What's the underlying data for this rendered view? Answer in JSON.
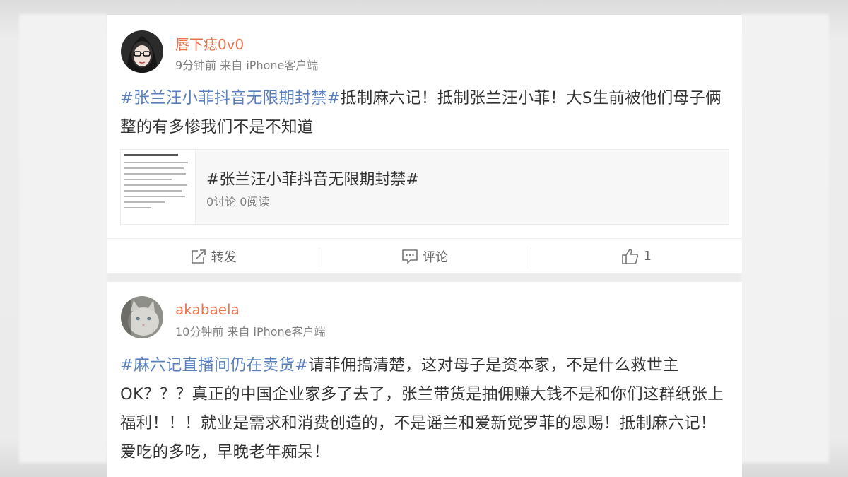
{
  "posts": [
    {
      "username": "唇下痣0v0",
      "meta": "9分钟前 来自 iPhone客户端",
      "hashtag": "#张兰汪小菲抖音无限期封禁#",
      "text": "抵制麻六记！抵制张兰汪小菲！大S生前被他们母子俩整的有多惨我们不是不知道",
      "topic": {
        "title": "#张兰汪小菲抖音无限期封禁#",
        "stats": "0讨论 0阅读"
      },
      "actions": {
        "repost": "转发",
        "comment": "评论",
        "like_count": "1"
      }
    },
    {
      "username": "akabaela",
      "meta": "10分钟前 来自 iPhone客户端",
      "hashtag": "#麻六记直播间仍在卖货#",
      "text": "请菲佣搞清楚，这对母子是资本家，不是什么救世主OK？？？真正的中国企业家多了去了，张兰带货是抽佣赚大钱不是和你们这群纸张上福利！！！就业是需求和消费创造的，不是谣兰和爱新觉罗菲的恩赐！抵制麻六记！爱吃的多吃，早晚老年痴呆！"
    }
  ],
  "colors": {
    "username": "#eb7350",
    "hashtag": "#5a7fbd",
    "body_text": "#333333",
    "meta_text": "#808080"
  },
  "icons": [
    "repost-icon",
    "comment-icon",
    "like-icon"
  ]
}
